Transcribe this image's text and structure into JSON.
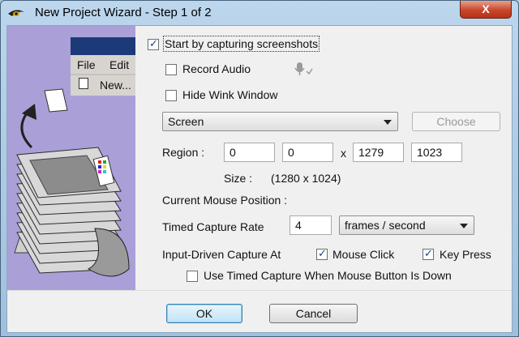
{
  "window": {
    "title": "New Project Wizard - Step 1 of 2",
    "close_label": "X"
  },
  "illustration": {
    "menu_file": "File",
    "menu_edit": "Edit",
    "menu_new": "New..."
  },
  "capture": {
    "start_label": "Start by capturing screenshots",
    "start_checked": true,
    "record_audio_label": "Record Audio",
    "record_audio_checked": false,
    "hide_window_label": "Hide Wink Window",
    "hide_window_checked": false
  },
  "source": {
    "selected": "Screen",
    "choose_label": "Choose"
  },
  "region": {
    "label": "Region :",
    "x": "0",
    "y": "0",
    "separator": "x",
    "width": "1279",
    "height": "1023",
    "size_label": "Size :",
    "size_value": "(1280 x 1024)"
  },
  "mouse": {
    "position_label": "Current Mouse Position :"
  },
  "timed": {
    "rate_label": "Timed Capture Rate",
    "rate_value": "4",
    "unit_selected": "frames / second"
  },
  "input_driven": {
    "label": "Input-Driven Capture At",
    "mouse_click_label": "Mouse Click",
    "mouse_click_checked": true,
    "key_press_label": "Key Press",
    "key_press_checked": true,
    "timed_when_down_label": "Use Timed Capture When Mouse Button Is Down",
    "timed_when_down_checked": false
  },
  "footer": {
    "ok_label": "OK",
    "cancel_label": "Cancel"
  }
}
